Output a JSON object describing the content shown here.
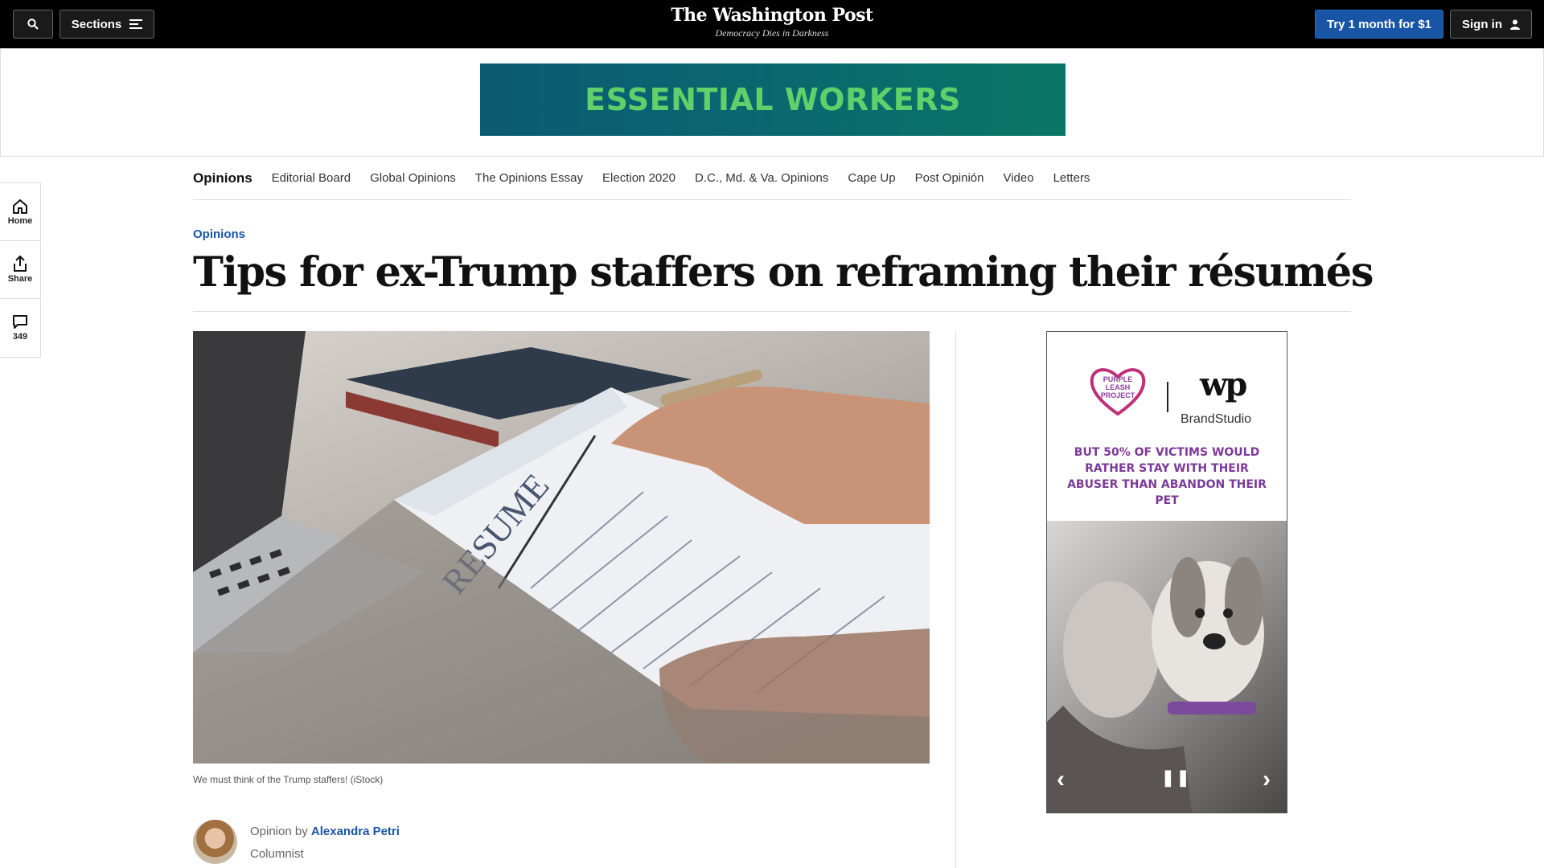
{
  "header": {
    "sections_label": "Sections",
    "logo": "The Washington Post",
    "tagline": "Democracy Dies in Darkness",
    "subscribe_label": "Try 1 month for $1",
    "signin_label": "Sign in"
  },
  "top_ad": {
    "text": "ESSENTIAL WORKERS"
  },
  "section_nav": {
    "items": [
      "Opinions",
      "Editorial Board",
      "Global Opinions",
      "The Opinions Essay",
      "Election 2020",
      "D.C., Md. & Va. Opinions",
      "Cape Up",
      "Post Opinión",
      "Video",
      "Letters"
    ]
  },
  "rail": {
    "home_label": "Home",
    "share_label": "Share",
    "comments_count": "349"
  },
  "article": {
    "kicker": "Opinions",
    "headline": "Tips for ex-Trump staffers on reframing their résumés",
    "image_alt": "RESUME",
    "caption": "We must think of the Trump staffers! (iStock)",
    "byline_prefix": "Opinion by",
    "author": "Alexandra Petri",
    "author_role": "Columnist"
  },
  "side_ad": {
    "brand_left": "PURPLE LEASH PROJECT",
    "brand_right": "BrandStudio",
    "message": "BUT 50% OF VICTIMS WOULD RATHER STAY WITH THEIR ABUSER THAN ABANDON THEIR PET"
  },
  "colors": {
    "accent_blue": "#1955a5",
    "topbar": "#000000",
    "ad_purple": "#7c3a98",
    "ad_green": "#5fd06a"
  }
}
